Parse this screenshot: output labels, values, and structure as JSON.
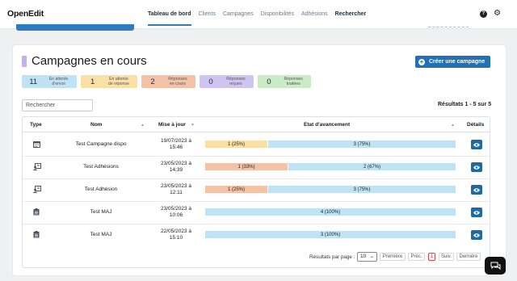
{
  "app": {
    "logo": "OpenEdit"
  },
  "nav": {
    "items": [
      "Tableau de bord",
      "Clients",
      "Campagnes",
      "Disponibilités",
      "Adhésions",
      "Rechercher"
    ]
  },
  "header_icons": {
    "help": "?",
    "settings": "⚙"
  },
  "page": {
    "title": "Campagnes en cours",
    "new_button": "Créer une campagne"
  },
  "badges": [
    {
      "count": "11",
      "label1": "En attente",
      "label2": "d'envoi",
      "color": "#bfe3f5"
    },
    {
      "count": "1",
      "label1": "En attente",
      "label2": "de réponse",
      "color": "#fbe0a6"
    },
    {
      "count": "2",
      "label1": "Réponses",
      "label2": "en cours",
      "color": "#f3c2a7"
    },
    {
      "count": "0",
      "label1": "Réponses",
      "label2": "reçues",
      "color": "#cfc5f2"
    },
    {
      "count": "0",
      "label1": "Réponses",
      "label2": "traitées",
      "color": "#c9ebc6"
    }
  ],
  "search": {
    "placeholder": "Rechercher"
  },
  "results": "Résultats 1 - 5 sur 5",
  "table": {
    "headers": [
      "Type",
      "Nom",
      "Mise à jour",
      "Etat d'avancement",
      "Détails"
    ],
    "rows": [
      {
        "type_icon": "calendar-icon",
        "name": "Test Campagne dispo",
        "date1": "19/07/2023 à",
        "date2": "15:46",
        "segments": [
          {
            "label": "1 (25%)",
            "value": 0.25,
            "color": "#fbe0a6"
          },
          {
            "label": "3 (75%)",
            "value": 0.75,
            "color": "#bfe3f5"
          }
        ]
      },
      {
        "type_icon": "membership-icon",
        "name": "Test Adhésions",
        "date1": "23/05/2023 à",
        "date2": "14:39",
        "segments": [
          {
            "label": "1 (33%)",
            "value": 0.33,
            "color": "#f3c2a7"
          },
          {
            "label": "2 (67%)",
            "value": 0.67,
            "color": "#bfe3f5"
          }
        ]
      },
      {
        "type_icon": "membership-icon",
        "name": "Test Adhésion",
        "date1": "23/05/2023 à",
        "date2": "12:11",
        "segments": [
          {
            "label": "1 (25%)",
            "value": 0.25,
            "color": "#f3c2a7"
          },
          {
            "label": "3 (75%)",
            "value": 0.75,
            "color": "#bfe3f5"
          }
        ]
      },
      {
        "type_icon": "clipboard-icon",
        "name": "Test MAJ",
        "date1": "23/05/2023 à",
        "date2": "10:06",
        "segments": [
          {
            "label": "4 (100%)",
            "value": 1.0,
            "color": "#bfe3f5"
          }
        ]
      },
      {
        "type_icon": "clipboard-icon",
        "name": "Test MAJ",
        "date1": "22/05/2023 à",
        "date2": "15:10",
        "segments": [
          {
            "label": "3 (100%)",
            "value": 1.0,
            "color": "#bfe3f5"
          }
        ]
      }
    ]
  },
  "pagination": {
    "per_page_label": "Résultats par page :",
    "per_page": "10",
    "first": "Première",
    "prev": "Préc.",
    "current": "1",
    "next": "Suiv.",
    "last": "Dernière"
  },
  "colors": {
    "accent": "#2470b5",
    "eye_button": "#1f6aa6"
  }
}
